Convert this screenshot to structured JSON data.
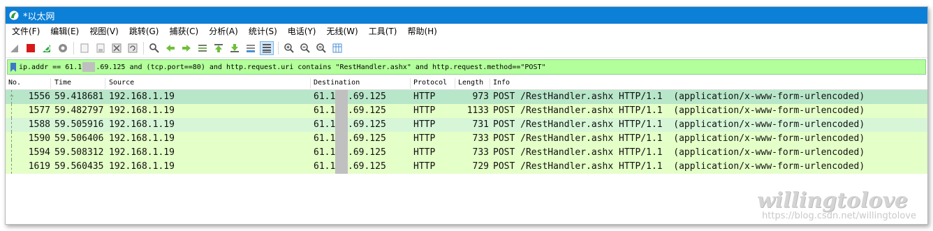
{
  "window": {
    "title": "*以太网"
  },
  "menu": [
    "文件(F)",
    "编辑(E)",
    "视图(V)",
    "跳转(G)",
    "捕获(C)",
    "分析(A)",
    "统计(S)",
    "电话(Y)",
    "无线(W)",
    "工具(T)",
    "帮助(H)"
  ],
  "toolbar": {
    "icons": [
      "shark-fin-start-icon",
      "stop-capture-icon",
      "restart-capture-icon",
      "capture-options-icon",
      "open-file-icon",
      "save-file-icon",
      "close-file-icon",
      "reload-file-icon",
      "find-packet-icon",
      "go-back-icon",
      "go-forward-icon",
      "go-to-packet-icon",
      "go-first-icon",
      "go-last-icon",
      "autoscroll-icon",
      "colorize-icon",
      "zoom-in-icon",
      "zoom-out-icon",
      "zoom-normal-icon",
      "resize-columns-icon"
    ]
  },
  "filter": {
    "part1": "ip.addr == 61.1",
    "part2": ".69.125 and (tcp.port==80) and http.request.uri contains \"RestHandler.ashx\" and http.request.method==\"POST\""
  },
  "columns": [
    "No.",
    "Time",
    "Source",
    "Destination",
    "Protocol",
    "Length",
    "Info"
  ],
  "packets": [
    {
      "no": "1556",
      "time": "59.418681",
      "src": "192.168.1.19",
      "dst_a": "61.1",
      "dst_b": ".69.125",
      "proto": "HTTP",
      "len": "973",
      "info": "POST /RestHandler.ashx HTTP/1.1  (application/x-www-form-urlencoded)"
    },
    {
      "no": "1577",
      "time": "59.482797",
      "src": "192.168.1.19",
      "dst_a": "61.1",
      "dst_b": ".69.125",
      "proto": "HTTP",
      "len": "1133",
      "info": "POST /RestHandler.ashx HTTP/1.1  (application/x-www-form-urlencoded)"
    },
    {
      "no": "1588",
      "time": "59.505916",
      "src": "192.168.1.19",
      "dst_a": "61.1",
      "dst_b": ".69.125",
      "proto": "HTTP",
      "len": "731",
      "info": "POST /RestHandler.ashx HTTP/1.1  (application/x-www-form-urlencoded)"
    },
    {
      "no": "1590",
      "time": "59.506406",
      "src": "192.168.1.19",
      "dst_a": "61.1",
      "dst_b": ".69.125",
      "proto": "HTTP",
      "len": "733",
      "info": "POST /RestHandler.ashx HTTP/1.1  (application/x-www-form-urlencoded)"
    },
    {
      "no": "1594",
      "time": "59.508312",
      "src": "192.168.1.19",
      "dst_a": "61.1",
      "dst_b": ".69.125",
      "proto": "HTTP",
      "len": "733",
      "info": "POST /RestHandler.ashx HTTP/1.1  (application/x-www-form-urlencoded)"
    },
    {
      "no": "1619",
      "time": "59.560435",
      "src": "192.168.1.19",
      "dst_a": "61.1",
      "dst_b": ".69.125",
      "proto": "HTTP",
      "len": "729",
      "info": "POST /RestHandler.ashx HTTP/1.1  (application/x-www-form-urlencoded)"
    }
  ],
  "watermark": {
    "text": "willingtolove",
    "url": "https://blog.csdn.net/willingtolove"
  },
  "colors": {
    "title_bar": "#0c7fd7",
    "filter_bg": "#b3ff9b",
    "selected_row": "#b8e6c9",
    "http_row": "#e4ffc7"
  }
}
